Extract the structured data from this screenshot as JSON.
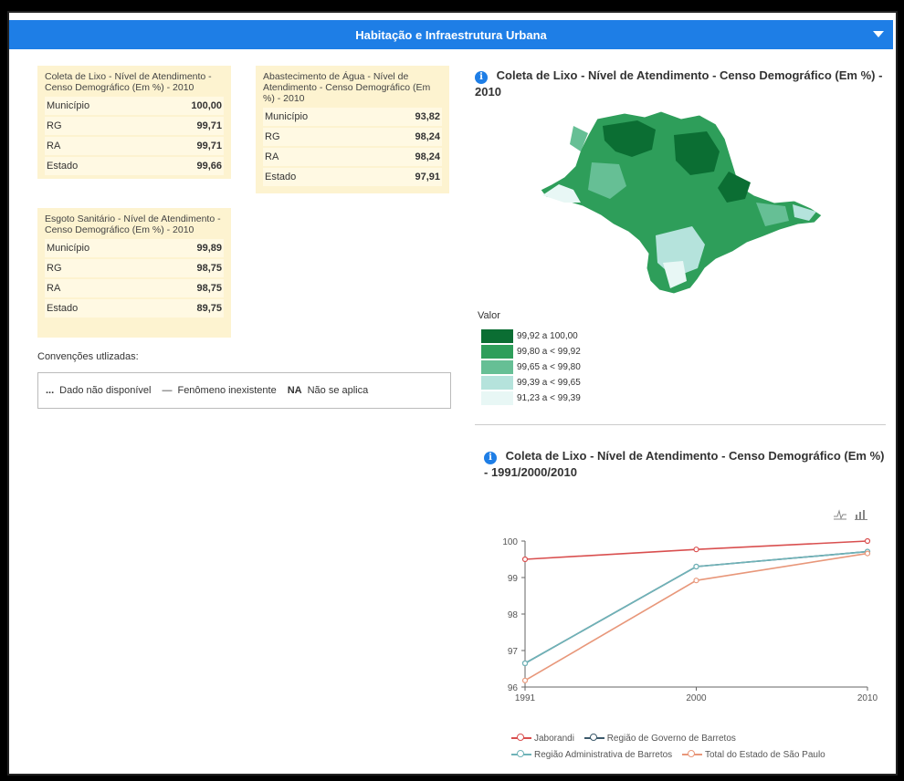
{
  "header": {
    "title": "Habitação e Infraestrutura Urbana"
  },
  "cards": [
    {
      "title": "Coleta de Lixo - Nível de Atendimento - Censo Demográfico (Em %) - 2010",
      "rows": [
        {
          "label": "Município",
          "value": "100,00"
        },
        {
          "label": "RG",
          "value": "99,71"
        },
        {
          "label": "RA",
          "value": "99,71"
        },
        {
          "label": "Estado",
          "value": "99,66"
        }
      ]
    },
    {
      "title": "Abastecimento de Água - Nível de Atendimento - Censo Demográfico (Em %) - 2010",
      "rows": [
        {
          "label": "Município",
          "value": "93,82"
        },
        {
          "label": "RG",
          "value": "98,24"
        },
        {
          "label": "RA",
          "value": "98,24"
        },
        {
          "label": "Estado",
          "value": "97,91"
        }
      ]
    },
    {
      "title": "Esgoto Sanitário - Nível de Atendimento - Censo Demográfico (Em %) - 2010",
      "rows": [
        {
          "label": "Município",
          "value": "99,89"
        },
        {
          "label": "RG",
          "value": "98,75"
        },
        {
          "label": "RA",
          "value": "98,75"
        },
        {
          "label": "Estado",
          "value": "89,75"
        }
      ]
    }
  ],
  "conventions": {
    "label": "Convenções utlizadas:",
    "na_symbol": "...",
    "na_text": "Dado não disponível",
    "none_symbol": "—",
    "none_text": "Fenômeno inexistente",
    "notapp_symbol": "NA",
    "notapp_text": "Não se aplica"
  },
  "map": {
    "info_icon": "i",
    "title": "Coleta de Lixo - Nível de Atendimento - Censo Demográfico (Em %) - 2010",
    "legend_title": "Valor",
    "legend": [
      {
        "label": "99,92 a 100,00",
        "color": "#0b6e33"
      },
      {
        "label": "99,80 a < 99,92",
        "color": "#2e9e5a"
      },
      {
        "label": "99,65 a < 99,80",
        "color": "#66bf95"
      },
      {
        "label": "99,39 a < 99,65",
        "color": "#b5e3dc"
      },
      {
        "label": "91,23 a < 99,39",
        "color": "#e8f7f5"
      }
    ]
  },
  "line_chart": {
    "info_icon": "i",
    "title": "Coleta de Lixo - Nível de Atendimento - Censo Demográfico (Em %) - 1991/2000/2010"
  },
  "chart_data": {
    "type": "line",
    "x": [
      "1991",
      "2000",
      "2010"
    ],
    "ylim": [
      96,
      100
    ],
    "yticks": [
      96,
      97,
      98,
      99,
      100
    ],
    "grid": false,
    "legend_position": "bottom",
    "series": [
      {
        "name": "Jaborandi",
        "color": "#d94f4f",
        "values": [
          99.5,
          99.77,
          100.0
        ]
      },
      {
        "name": "Região de Governo de Barretos",
        "color": "#3d5a6c",
        "values": [
          96.65,
          99.3,
          99.71
        ]
      },
      {
        "name": "Região Administrativa de Barretos",
        "color": "#6fb3b8",
        "values": [
          96.65,
          99.3,
          99.71
        ]
      },
      {
        "name": "Total do Estado de São Paulo",
        "color": "#e8977a",
        "values": [
          96.18,
          98.92,
          99.66
        ]
      }
    ]
  }
}
